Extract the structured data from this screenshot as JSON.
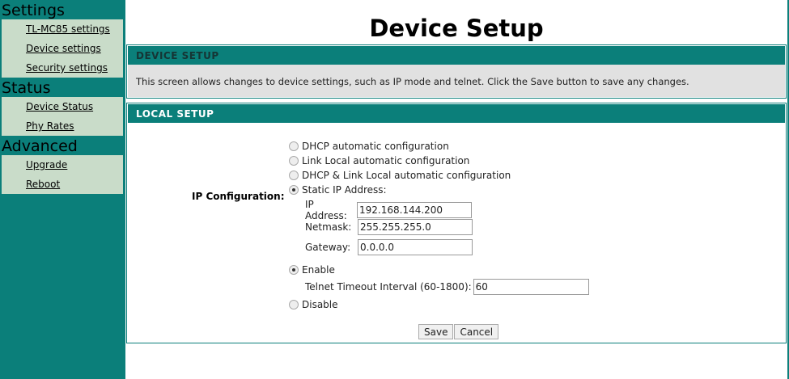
{
  "sidebar": {
    "sections": [
      {
        "title": "Settings",
        "items": [
          "TL-MC85 settings",
          "Device settings",
          "Security settings"
        ]
      },
      {
        "title": "Status",
        "items": [
          "Device Status",
          "Phy Rates"
        ]
      },
      {
        "title": "Advanced",
        "items": [
          "Upgrade",
          "Reboot"
        ]
      }
    ]
  },
  "page_title": "Device Setup",
  "device_setup": {
    "header": "DEVICE SETUP",
    "description": "This screen allows changes to device settings, such as IP mode and telnet. Click the Save button to save any changes."
  },
  "local_setup": {
    "header": "LOCAL SETUP",
    "ip_config_label": "IP Configuration:",
    "options": [
      "DHCP automatic configuration",
      "Link Local automatic configuration",
      "DHCP & Link Local automatic configuration",
      "Static IP Address:"
    ],
    "ip_label": "IP Address:",
    "ip_value": "192.168.144.200",
    "netmask_label": "Netmask:",
    "netmask_value": "255.255.255.0",
    "gateway_label": "Gateway:",
    "gateway_value": "0.0.0.0",
    "telnet_enable": "Enable",
    "telnet_timeout_label": "Telnet Timeout Interval (60-1800):",
    "telnet_timeout_value": "60",
    "telnet_disable": "Disable",
    "save": "Save",
    "cancel": "Cancel"
  }
}
